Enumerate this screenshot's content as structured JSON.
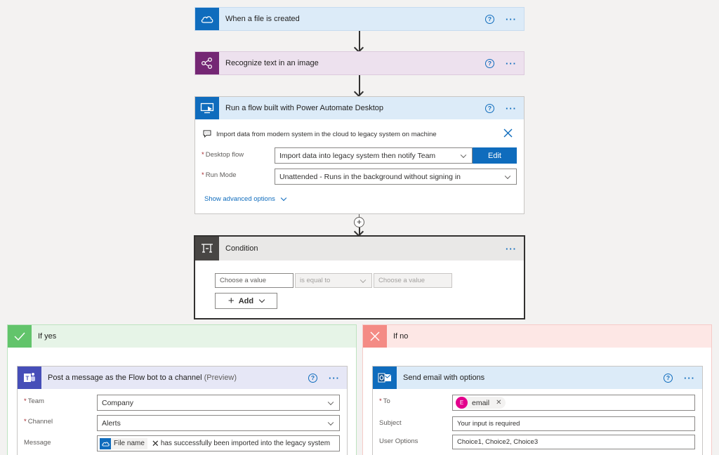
{
  "steps": {
    "trigger": {
      "title": "When a file is created"
    },
    "recognize": {
      "title": "Recognize text in an image"
    },
    "desktop": {
      "title": "Run a flow built with Power Automate Desktop",
      "info": "Import data from modern system in the cloud to legacy system on machine",
      "desktop_flow_label": "Desktop flow",
      "desktop_flow_value": "Import data into legacy system then notify Team",
      "edit_label": "Edit",
      "run_mode_label": "Run Mode",
      "run_mode_value": "Unattended - Runs in the background without signing in",
      "advanced_label": "Show advanced options"
    },
    "condition": {
      "title": "Condition",
      "left_placeholder": "Choose a value",
      "operator": "is equal to",
      "right_placeholder": "Choose a value",
      "add_label": "Add"
    }
  },
  "branches": {
    "yes": {
      "title": "If yes",
      "action": {
        "title": "Post a message as the Flow bot to a channel",
        "title_suffix": "(Preview)",
        "team_label": "Team",
        "team_value": "Company",
        "channel_label": "Channel",
        "channel_value": "Alerts",
        "message_label": "Message",
        "message_token": "File name",
        "message_text": "has successfully been imported into the legacy system"
      }
    },
    "no": {
      "title": "If no",
      "action": {
        "title": "Send email with options",
        "to_label": "To",
        "to_token_initial": "E",
        "to_token": "email",
        "subject_label": "Subject",
        "subject_value": "Your input is required",
        "options_label": "User Options",
        "options_value": "Choice1, Choice2, Choice3"
      }
    }
  },
  "colors": {
    "onedrive": "#0f6cbd",
    "ai_builder": "#742774",
    "desktop": "#0f6cbd",
    "condition": "#484644",
    "teams": "#464eb8",
    "outlook": "#0f6cbd",
    "yes": "#62c46b",
    "no": "#f48b85"
  }
}
